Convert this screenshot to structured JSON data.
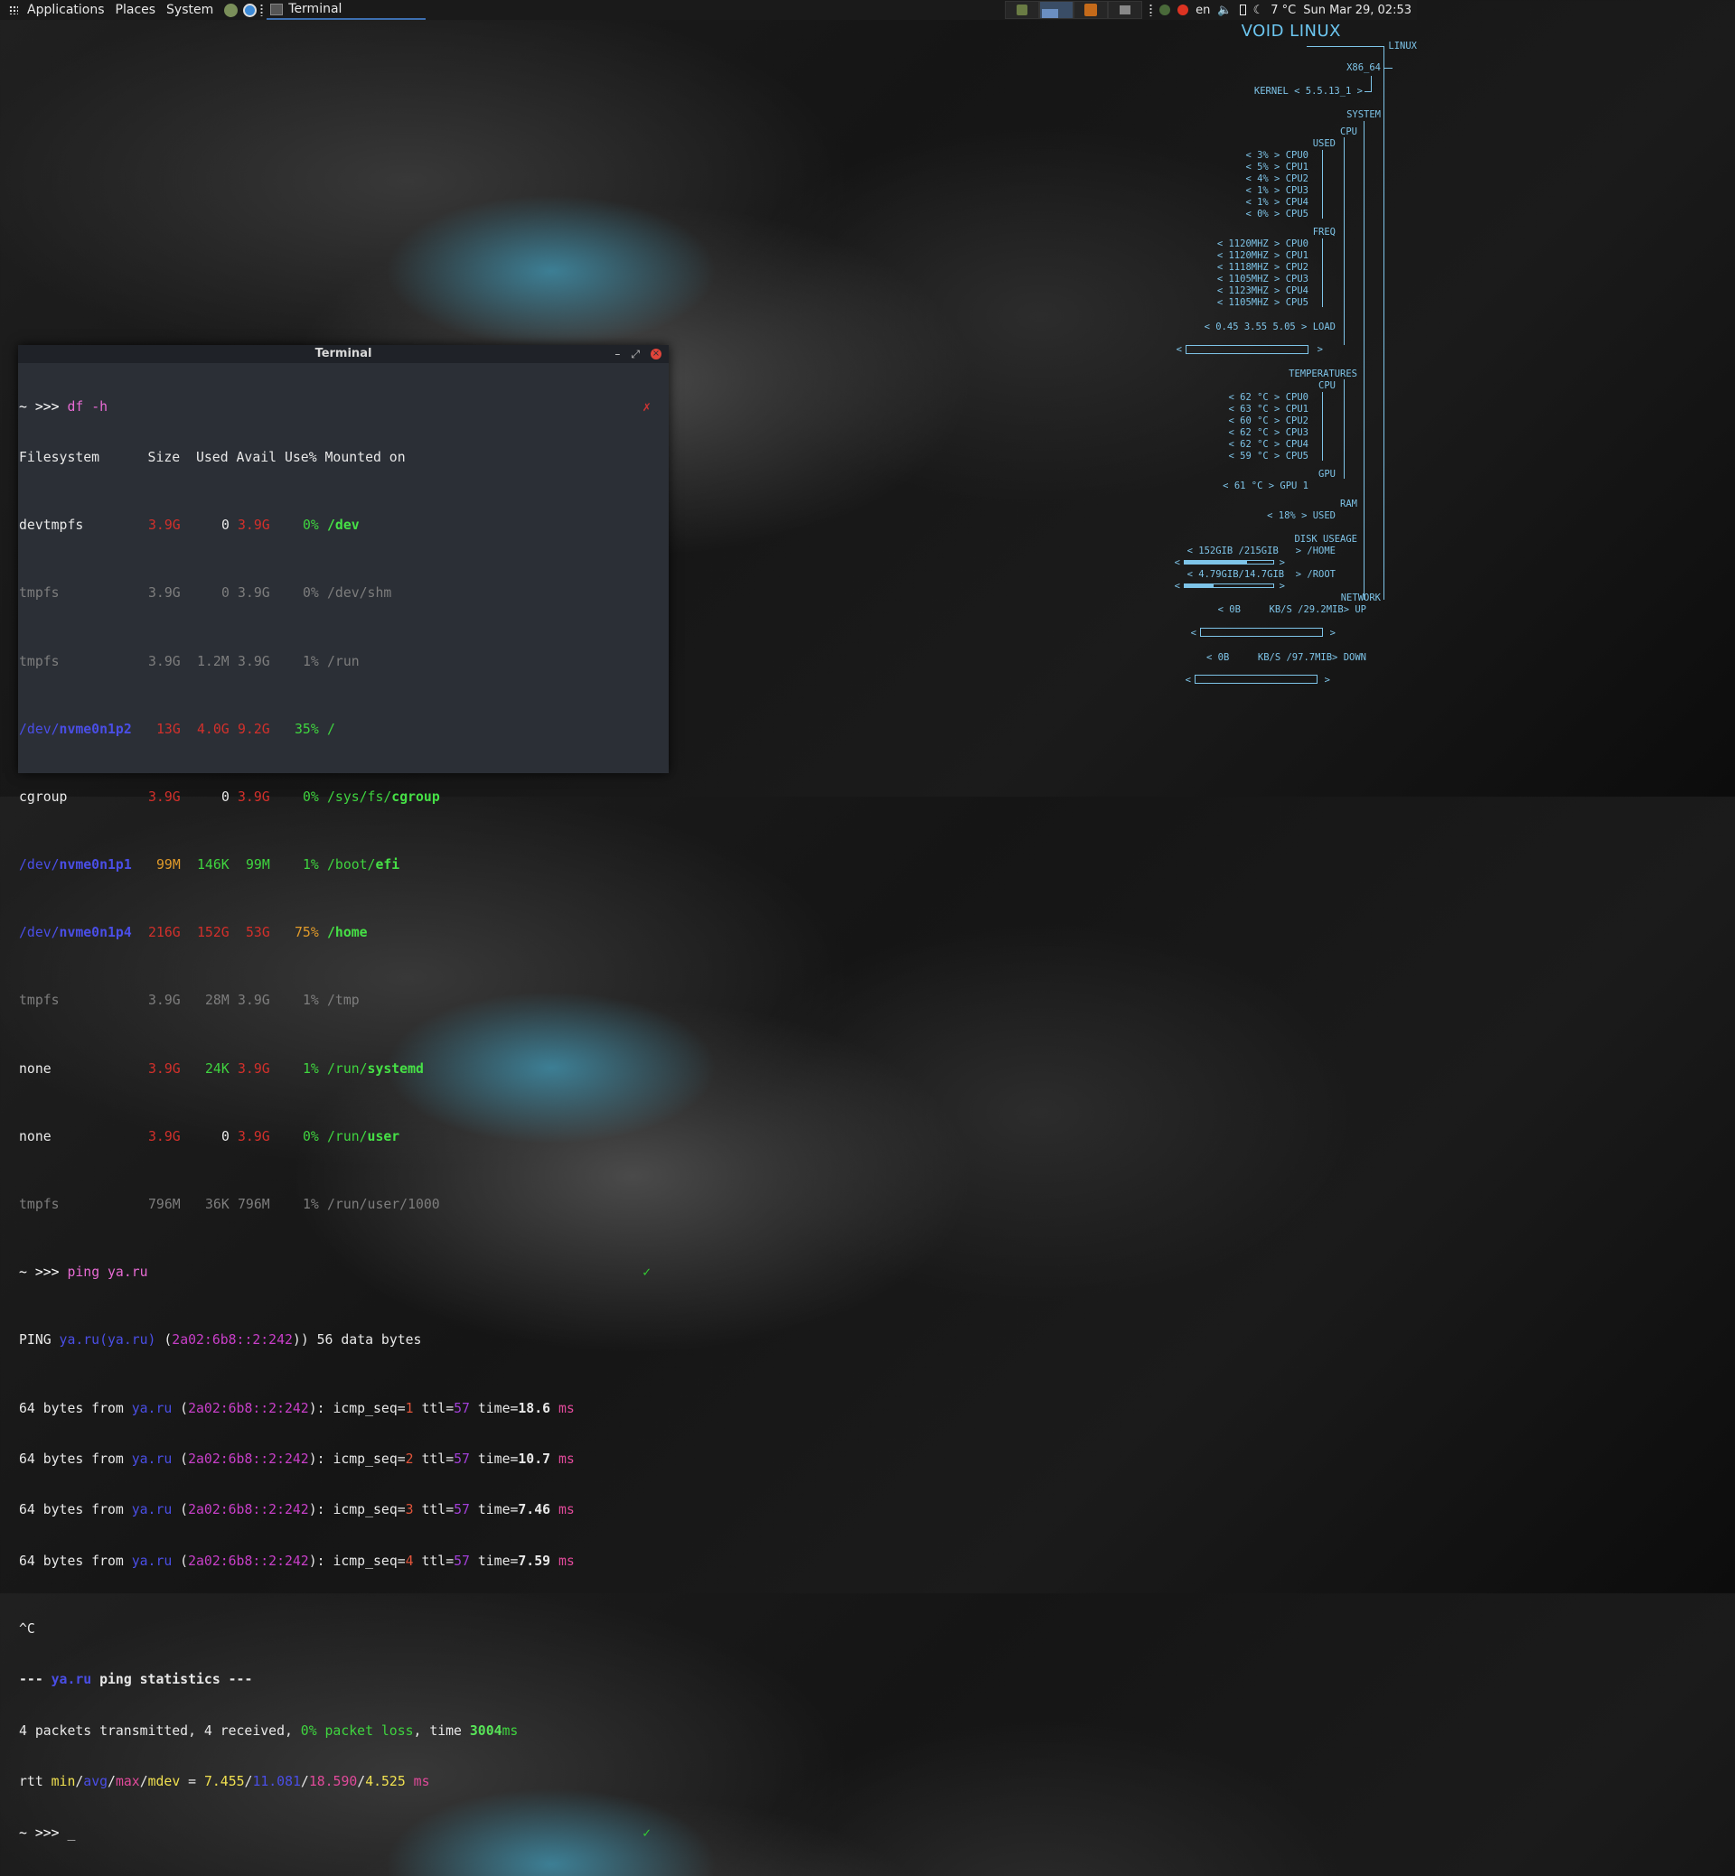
{
  "panel": {
    "menus": [
      "Applications",
      "Places",
      "System"
    ],
    "task_title": "Terminal",
    "tray": {
      "lang": "en",
      "weather": "7 °C",
      "datetime": "Sun Mar 29, 02:53"
    }
  },
  "terminal": {
    "title": "Terminal",
    "prompt": "~ >>>",
    "cmd1": "df -h",
    "df_header": "Filesystem      Size  Used Avail Use% Mounted on",
    "df_rows": [
      {
        "fs": "devtmpfs",
        "size": "3.9G",
        "used": "0",
        "avail": "3.9G",
        "use": "0%",
        "mnt_a": "",
        "mnt_b": "/dev"
      },
      {
        "fs": "tmpfs",
        "size": "3.9G",
        "used": "0",
        "avail": "3.9G",
        "use": "0%",
        "mnt_a": "/dev/shm",
        "mnt_b": ""
      },
      {
        "fs": "tmpfs",
        "size": "3.9G",
        "used": "1.2M",
        "avail": "3.9G",
        "use": "1%",
        "mnt_a": "/run",
        "mnt_b": ""
      },
      {
        "fs_a": "/dev/",
        "fs_b": "nvme0n1p2",
        "size": "13G",
        "used": "4.0G",
        "avail": "9.2G",
        "use": "35%",
        "mnt_a": "/",
        "mnt_b": ""
      },
      {
        "fs": "cgroup",
        "size": "3.9G",
        "used": "0",
        "avail": "3.9G",
        "use": "0%",
        "mnt_a": "/sys/fs/",
        "mnt_b": "cgroup"
      },
      {
        "fs_a": "/dev/",
        "fs_b": "nvme0n1p1",
        "size": "99M",
        "used": "146K",
        "avail": "99M",
        "use": "1%",
        "mnt_a": "/boot/",
        "mnt_b": "efi"
      },
      {
        "fs_a": "/dev/",
        "fs_b": "nvme0n1p4",
        "size": "216G",
        "used": "152G",
        "avail": "53G",
        "use": "75%",
        "mnt_a": "",
        "mnt_b": "/home"
      },
      {
        "fs": "tmpfs",
        "size": "3.9G",
        "used": "28M",
        "avail": "3.9G",
        "use": "1%",
        "mnt_a": "/tmp",
        "mnt_b": ""
      },
      {
        "fs": "none",
        "size": "3.9G",
        "used": "24K",
        "avail": "3.9G",
        "use": "1%",
        "mnt_a": "/run/",
        "mnt_b": "systemd"
      },
      {
        "fs": "none",
        "size": "3.9G",
        "used": "0",
        "avail": "3.9G",
        "use": "0%",
        "mnt_a": "/run/",
        "mnt_b": "user"
      },
      {
        "fs": "tmpfs",
        "size": "796M",
        "used": "36K",
        "avail": "796M",
        "use": "1%",
        "mnt_a": "/run/user/1000",
        "mnt_b": ""
      }
    ],
    "cmd2": "ping ya.ru",
    "ping_header": {
      "a": "PING ",
      "host": "ya.ru(ya.ru)",
      "b": " (",
      "ip": "2a02:6b8::2:242",
      "c": ")) 56 data bytes"
    },
    "ping_lines": [
      {
        "seq": "1",
        "ttl": "57",
        "time": "18.6"
      },
      {
        "seq": "2",
        "ttl": "57",
        "time": "10.7"
      },
      {
        "seq": "3",
        "ttl": "57",
        "time": "7.46"
      },
      {
        "seq": "4",
        "ttl": "57",
        "time": "7.59"
      }
    ],
    "ping_host": "ya.ru",
    "ping_ip": "2a02:6b8::2:242",
    "interrupt": "^C",
    "stats_a": "--- ",
    "stats_host": "ya.ru",
    "stats_b": " ping statistics ---",
    "tx_a": "4 packets transmitted, 4 received, ",
    "tx_loss": "0% packet loss",
    "tx_b": ", time ",
    "tx_time": "3004",
    "tx_ms": "ms",
    "rtt_label": "rtt ",
    "rtt_min": "min",
    "rtt_avg": "avg",
    "rtt_max": "max",
    "rtt_mdev": "mdev",
    "rtt_eq": " = ",
    "rtt_v1": "7.455",
    "rtt_v2": "11.081",
    "rtt_v3": "18.590",
    "rtt_v4": "4.525",
    "rtt_unit": " ms",
    "cursor": "_",
    "mark_x": "✗",
    "mark_ok": "✓"
  },
  "conky": {
    "title": "VOID LINUX",
    "linux": "LINUX",
    "arch": "X86_64",
    "kernel": "KERNEL < 5.5.13_1 >",
    "system": "SYSTEM",
    "cpu": "CPU",
    "used": "USED",
    "cpu_used": [
      "< 3% > CPU0",
      "< 5% > CPU1",
      "< 4% > CPU2",
      "< 1% > CPU3",
      "< 1% > CPU4",
      "< 0% > CPU5"
    ],
    "freq": "FREQ",
    "cpu_freq": [
      "< 1120MHZ > CPU0",
      "< 1120MHZ > CPU1",
      "< 1118MHZ > CPU2",
      "< 1105MHZ > CPU3",
      "< 1123MHZ > CPU4",
      "< 1105MHZ > CPU5"
    ],
    "load": "< 0.45 3.55 5.05 > LOAD",
    "bar_lt": "<",
    "bar_gt": ">",
    "temperatures": "TEMPERATURES",
    "temps": [
      "< 62 °C > CPU0",
      "< 63 °C > CPU1",
      "< 60 °C > CPU2",
      "< 62 °C > CPU3",
      "< 62 °C > CPU4",
      "< 59 °C > CPU5"
    ],
    "gpu": "GPU",
    "gpu_temp": "< 61 °C > GPU 1",
    "ram": "RAM",
    "ram_used": "< 18% > USED",
    "disk": "DISK USEAGE",
    "home": "< 152GIB /215GIB   > /HOME",
    "home_fill": 0.7,
    "root": "< 4.79GIB/14.7GIB  > /ROOT",
    "root_fill": 0.33,
    "network": "NETWORK",
    "up": "< 0B     KB/S /29.2MIB> UP",
    "down": "< 0B     KB/S /97.7MIB> DOWN"
  },
  "colors": {
    "accent": "#7ec4e8",
    "terminal_bg": "#2b2f36",
    "panel_bg": "#1a1a1a"
  }
}
